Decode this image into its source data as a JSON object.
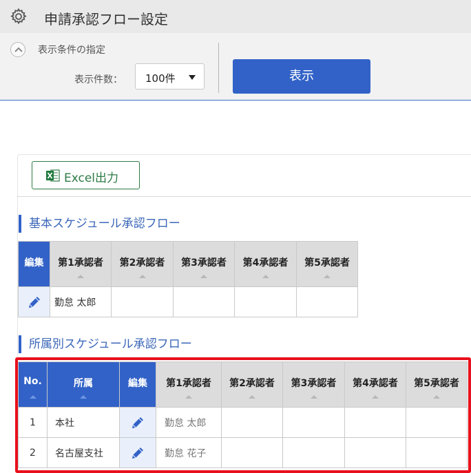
{
  "header": {
    "title": "申請承認フロー設定",
    "icon": "gear-icon"
  },
  "filter": {
    "title": "表示条件の指定",
    "count_label": "表示件数：",
    "count_value": "100件",
    "show_button": "表示"
  },
  "toolbar": {
    "excel_label": "Excel出力"
  },
  "basic_section": {
    "title": "基本スケジュール承認フロー",
    "headers": [
      "編集",
      "第1承認者",
      "第2承認者",
      "第3承認者",
      "第4承認者",
      "第5承認者"
    ],
    "rows": [
      {
        "approver1": "勤怠 太郎",
        "approver2": "",
        "approver3": "",
        "approver4": "",
        "approver5": ""
      }
    ]
  },
  "dept_section": {
    "title": "所属別スケジュール承認フロー",
    "headers": [
      "No.",
      "所属",
      "編集",
      "第1承認者",
      "第2承認者",
      "第3承認者",
      "第4承認者",
      "第5承認者"
    ],
    "rows": [
      {
        "no": "1",
        "dept": "本社",
        "approver1": "勤怠 太郎"
      },
      {
        "no": "2",
        "dept": "名古屋支社",
        "approver1": "勤怠 花子"
      }
    ]
  },
  "colors": {
    "accent": "#3262c7",
    "highlight": "#e8101c",
    "excel": "#2d7a45"
  }
}
